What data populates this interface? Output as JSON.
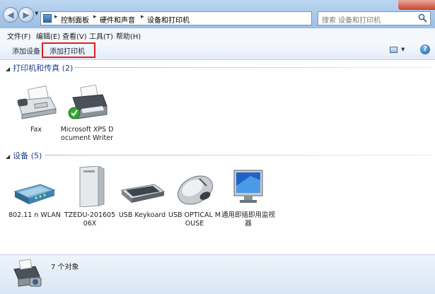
{
  "address_bar": {
    "crumbs": [
      "控制面板",
      "硬件和声音",
      "设备和打印机"
    ]
  },
  "search": {
    "placeholder": "搜索 设备和打印机"
  },
  "menu": [
    "文件(F)",
    "编辑(E)",
    "查看(V)",
    "工具(T)",
    "帮助(H)"
  ],
  "toolbar": {
    "add_device": "添加设备",
    "add_printer": "添加打印机"
  },
  "groups": {
    "printers": {
      "title": "打印机和传真 (2)"
    },
    "devices": {
      "title": "设备 (5)"
    }
  },
  "printers": [
    {
      "label": "Fax",
      "icon": "fax-icon"
    },
    {
      "label": "Microsoft XPS Document Writer",
      "icon": "printer-icon",
      "default": true
    }
  ],
  "devices": [
    {
      "label": "802.11 n WLAN",
      "icon": "router-icon"
    },
    {
      "label": "TZEDU-20160506X",
      "icon": "computer-tower-icon"
    },
    {
      "label": "USB Keykoard",
      "icon": "keyboard-icon"
    },
    {
      "label": "USB OPTICAL MOUSE",
      "icon": "mouse-icon"
    },
    {
      "label": "通用即插即用监视器",
      "icon": "monitor-icon"
    }
  ],
  "status": {
    "text": "7 个对象",
    "icon": "printer-camera-icon"
  },
  "colors": {
    "group_heading": "#1e3f8a",
    "highlight": "#e02020",
    "default_check": "#2fa82f"
  }
}
